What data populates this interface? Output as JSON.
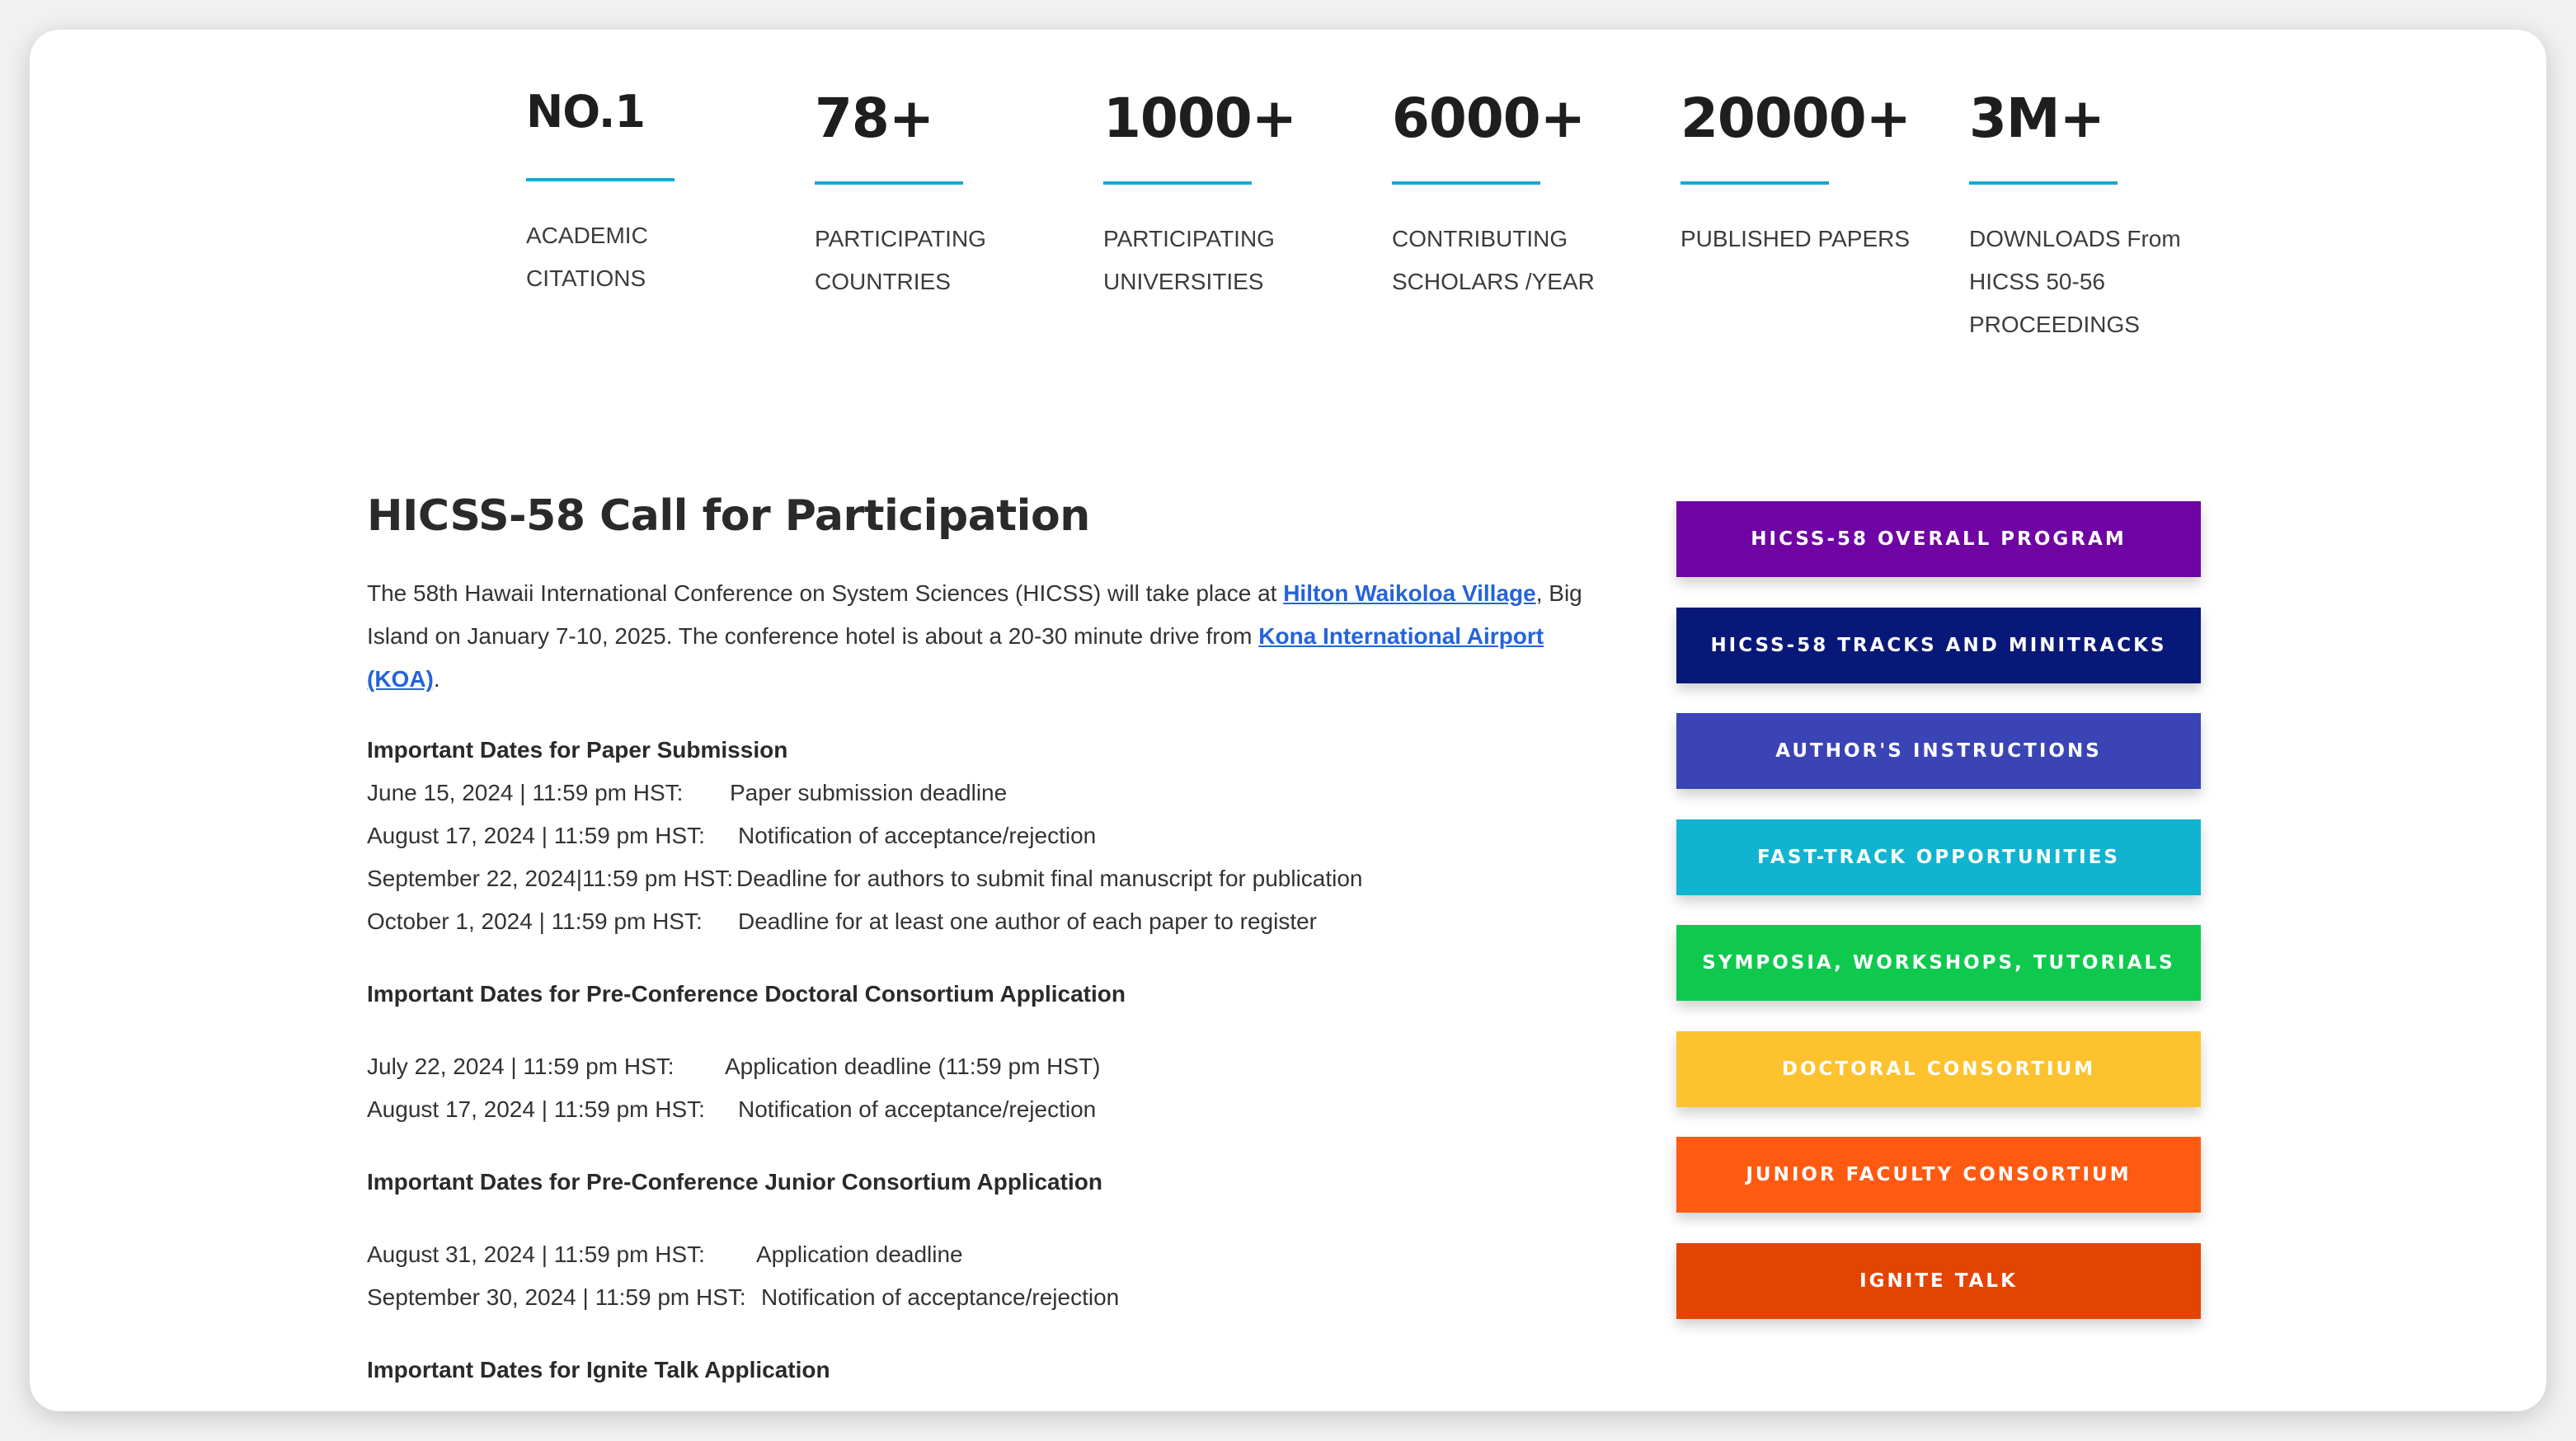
{
  "stats": [
    {
      "value": "NO.1",
      "label_lines": [
        "ACADEMIC",
        "CITATIONS"
      ]
    },
    {
      "value": "78+",
      "label_lines": [
        "PARTICIPATING",
        "COUNTRIES"
      ]
    },
    {
      "value": "1000+",
      "label_lines": [
        "PARTICIPATING",
        "UNIVERSITIES"
      ]
    },
    {
      "value": "6000+",
      "label_lines": [
        "CONTRIBUTING",
        "SCHOLARS /YEAR"
      ]
    },
    {
      "value": "20000+",
      "label_lines": [
        "PUBLISHED PAPERS"
      ]
    },
    {
      "value": "3M+",
      "label_lines": [
        "DOWNLOADS From",
        "HICSS 50-56",
        "PROCEEDINGS"
      ]
    }
  ],
  "main": {
    "title": "HICSS-58 Call for Participation",
    "intro": {
      "text1": "The 58th Hawaii International Conference on System Sciences (HICSS) will take place at ",
      "link1": "Hilton Waikoloa Village",
      "text2": ", Big Island on January 7-10, 2025. The conference hotel is about a 20-30 minute drive from ",
      "link2": "Kona International Airport (KOA)",
      "text3": "."
    },
    "sections": [
      {
        "heading": "Important Dates for Paper Submission",
        "spaced": false,
        "rows": [
          {
            "date": "June 15, 2024 | 11:59 pm HST:",
            "desc": "Paper submission deadline"
          },
          {
            "date": "August 17, 2024 | 11:59 pm HST:",
            "desc": "Notification of acceptance/rejection"
          },
          {
            "date": "September 22, 2024|11:59 pm HST:",
            "desc": "Deadline for authors to submit final manuscript for publication"
          },
          {
            "date": "October 1, 2024 | 11:59 pm HST:",
            "desc": "Deadline for at least one author of each paper to register"
          }
        ]
      },
      {
        "heading": "Important Dates for Pre-Conference Doctoral Consortium Application",
        "spaced": true,
        "rows": [
          {
            "date": "July 22, 2024 | 11:59 pm HST:",
            "desc": "Application deadline (11:59 pm HST)"
          },
          {
            "date": "August 17, 2024 | 11:59 pm HST:",
            "desc": "Notification of acceptance/rejection"
          }
        ]
      },
      {
        "heading": "Important Dates for Pre-Conference Junior Consortium Application",
        "spaced": true,
        "rows": [
          {
            "date": "August 31, 2024 | 11:59 pm HST:",
            "desc": "Application deadline"
          },
          {
            "date": "September 30, 2024 | 11:59 pm HST:",
            "desc": "Notification of acceptance/rejection"
          }
        ]
      },
      {
        "heading": "Important Dates for Ignite Talk Application",
        "spaced": false,
        "rows": []
      }
    ]
  },
  "buttons": [
    {
      "label": "HICSS-58 OVERALL PROGRAM",
      "color": "#6f03a4"
    },
    {
      "label": "HICSS-58 TRACKS AND MINITRACKS",
      "color": "#081878"
    },
    {
      "label": "AUTHOR'S INSTRUCTIONS",
      "color": "#3a44b4"
    },
    {
      "label": "FAST-TRACK OPPORTUNITIES",
      "color": "#10b4d0"
    },
    {
      "label": "SYMPOSIA, WORKSHOPS, TUTORIALS",
      "color": "#0ec94e"
    },
    {
      "label": "DOCTORAL CONSORTIUM",
      "color": "#fdc22e"
    },
    {
      "label": "JUNIOR FACULTY CONSORTIUM",
      "color": "#ff5a12"
    },
    {
      "label": "IGNITE TALK",
      "color": "#e44402"
    }
  ],
  "colors": {
    "accent_line": "#1aa5d8",
    "link": "#2563d9"
  }
}
